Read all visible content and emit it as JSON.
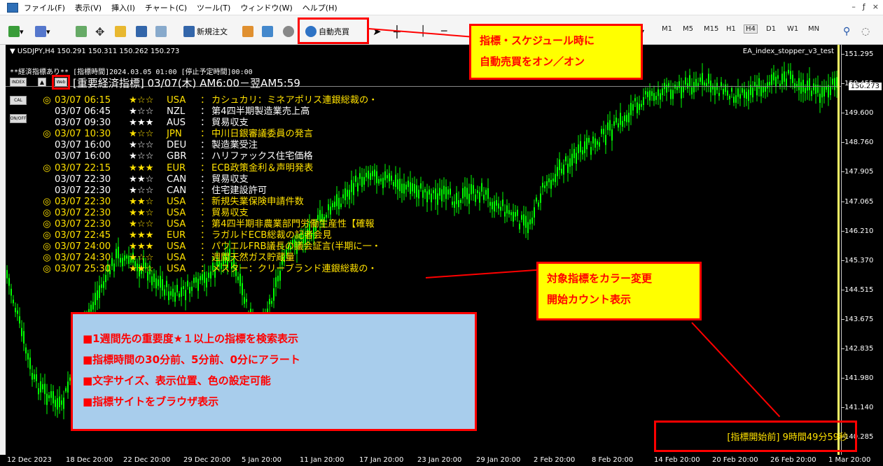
{
  "menu": [
    "ファイル(F)",
    "表示(V)",
    "挿入(I)",
    "チャート(C)",
    "ツール(T)",
    "ウィンドウ(W)",
    "ヘルプ(H)"
  ],
  "window_controls": [
    "–",
    "ƒ",
    "×"
  ],
  "toolbar": {
    "new_order_label": "新規注文",
    "autotrade_label": "自動売買",
    "timeframes": [
      "M1",
      "M5",
      "M15",
      "H1",
      "H4",
      "D1",
      "W1",
      "MN"
    ],
    "active_timeframe": "H4"
  },
  "chart": {
    "header": "▼ USDJPY,H4  150.291 150.311 150.262 150.273",
    "ea_name": "EA_index_stopper_v3_test",
    "info_line": "**経済指標あり** [指標時間]2024.03.05 01:00 [停止予定時間]00:00",
    "buttons": {
      "index": "INDEX",
      "arrow": "▲",
      "web": "Web",
      "cal": "CAL",
      "onoff": "ON/OFF"
    },
    "title": "[重要経済指標] 03/07(木) AM6:00－翌AM5:59",
    "current_price": "150.273",
    "price_ticks": [
      "151.295",
      "150.455",
      "149.600",
      "148.760",
      "147.905",
      "147.065",
      "146.210",
      "145.370",
      "144.515",
      "143.675",
      "142.835",
      "141.980",
      "141.140",
      "140.285"
    ],
    "time_ticks": [
      "12 Dec 2023",
      "18 Dec 20:00",
      "22 Dec 20:00",
      "29 Dec 20:00",
      "5 Jan 20:00",
      "11 Jan 20:00",
      "17 Jan 20:00",
      "23 Jan 20:00",
      "29 Jan 20:00",
      "2 Feb 20:00",
      "8 Feb 20:00",
      "14 Feb 20:00",
      "20 Feb 20:00",
      "26 Feb 20:00",
      "1 Mar 20:00"
    ],
    "countdown": "[指標開始前] 9時間49分59秒"
  },
  "events": [
    {
      "mark": "◎",
      "time": "03/07 06:15",
      "stars": "★☆☆",
      "country": "USA",
      "name": "カシュカリ：ミネアポリス連銀総裁の・",
      "highlight": true
    },
    {
      "mark": "",
      "time": "03/07 06:45",
      "stars": "★☆☆",
      "country": "NZL",
      "name": "第4四半期製造業売上高",
      "highlight": false
    },
    {
      "mark": "",
      "time": "03/07 09:30",
      "stars": "★★★",
      "country": "AUS",
      "name": "貿易収支",
      "highlight": false
    },
    {
      "mark": "◎",
      "time": "03/07 10:30",
      "stars": "★☆☆",
      "country": "JPN",
      "name": "中川日銀審議委員の発言",
      "highlight": true
    },
    {
      "mark": "",
      "time": "03/07 16:00",
      "stars": "★☆☆",
      "country": "DEU",
      "name": "製造業受注",
      "highlight": false
    },
    {
      "mark": "",
      "time": "03/07 16:00",
      "stars": "★☆☆",
      "country": "GBR",
      "name": "ハリファックス住宅価格",
      "highlight": false
    },
    {
      "mark": "◎",
      "time": "03/07 22:15",
      "stars": "★★★",
      "country": "EUR",
      "name": "ECB政策金利＆声明発表",
      "highlight": true
    },
    {
      "mark": "",
      "time": "03/07 22:30",
      "stars": "★★☆",
      "country": "CAN",
      "name": "貿易収支",
      "highlight": false
    },
    {
      "mark": "",
      "time": "03/07 22:30",
      "stars": "★☆☆",
      "country": "CAN",
      "name": "住宅建設許可",
      "highlight": false
    },
    {
      "mark": "◎",
      "time": "03/07 22:30",
      "stars": "★★☆",
      "country": "USA",
      "name": "新規失業保険申請件数",
      "highlight": true
    },
    {
      "mark": "◎",
      "time": "03/07 22:30",
      "stars": "★★☆",
      "country": "USA",
      "name": "貿易収支",
      "highlight": true
    },
    {
      "mark": "◎",
      "time": "03/07 22:30",
      "stars": "★☆☆",
      "country": "USA",
      "name": "第4四半期非農業部門労働生産性【確報",
      "highlight": true
    },
    {
      "mark": "◎",
      "time": "03/07 22:45",
      "stars": "★★★",
      "country": "EUR",
      "name": "ラガルドECB総裁の記者会見",
      "highlight": true
    },
    {
      "mark": "◎",
      "time": "03/07 24:00",
      "stars": "★★★",
      "country": "USA",
      "name": "パウエルFRB議長の議会証言(半期に一・",
      "highlight": true
    },
    {
      "mark": "◎",
      "time": "03/07 24:30",
      "stars": "★☆☆",
      "country": "USA",
      "name": "週間天然ガス貯蔵量",
      "highlight": true
    },
    {
      "mark": "◎",
      "time": "03/07 25:30",
      "stars": "★★☆",
      "country": "USA",
      "name": "メスター：クリーブランド連銀総裁の・",
      "highlight": true
    }
  ],
  "annotations": {
    "autotrade_callout": [
      "指標・スケジュール時に",
      "自動売買をオン／オン"
    ],
    "color_callout": [
      "対象指標をカラー変更",
      "開始カウント表示"
    ],
    "feature_list": [
      "■1週間先の重要度★１以上の指標を検索表示",
      "■指標時間の30分前、5分前、0分にアラート",
      "■文字サイズ、表示位置、色の設定可能",
      "■指標サイトをブラウザ表示"
    ]
  },
  "colors": {
    "candle": "#00ff00",
    "highlight_text": "#ffe100",
    "annotation_red": "#ff0000",
    "callout_yellow": "#ffff00",
    "feature_box_blue": "#a8cdec"
  }
}
